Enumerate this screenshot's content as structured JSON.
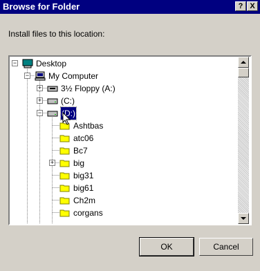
{
  "window": {
    "title": "Browse for Folder",
    "help_label": "?",
    "close_label": "X"
  },
  "instruction": "Install files to this location:",
  "tree": {
    "items": [
      {
        "label": "Desktop",
        "icon": "desktop-icon",
        "expander": "minus"
      },
      {
        "label": "My Computer",
        "icon": "computer-icon",
        "expander": "minus"
      },
      {
        "label": "3½ Floppy (A:)",
        "icon": "floppy-drive-icon",
        "expander": "plus"
      },
      {
        "label": "(C:)",
        "icon": "hard-drive-icon",
        "expander": "plus"
      },
      {
        "label": "(D:)",
        "icon": "hard-drive-icon",
        "expander": "minus",
        "selected": true
      },
      {
        "label": "Ashtbas",
        "icon": "folder-icon",
        "expander": ""
      },
      {
        "label": "atc06",
        "icon": "folder-icon",
        "expander": ""
      },
      {
        "label": "Bc7",
        "icon": "folder-icon",
        "expander": "plus"
      },
      {
        "label": "big",
        "icon": "folder-icon",
        "expander": ""
      },
      {
        "label": "big31",
        "icon": "folder-icon",
        "expander": ""
      },
      {
        "label": "big61",
        "icon": "folder-icon",
        "expander": ""
      },
      {
        "label": "Ch2m",
        "icon": "folder-icon",
        "expander": ""
      },
      {
        "label": "corgans",
        "icon": "folder-icon",
        "expander": ""
      }
    ]
  },
  "buttons": {
    "ok": "OK",
    "cancel": "Cancel"
  },
  "colors": {
    "titlebar": "#000080",
    "face": "#d4d0c8",
    "selection": "#000080",
    "folder": "#ffff00"
  }
}
